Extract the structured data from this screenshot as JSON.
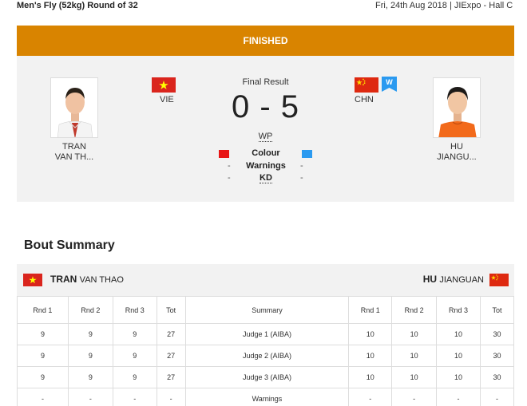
{
  "header": {
    "event": "Men's Fly (52kg) Round of 32",
    "meta": "Fri, 24th Aug 2018 | JIExpo - Hall C"
  },
  "status": "FINISHED",
  "result": {
    "final_label": "Final Result",
    "score": "0 - 5",
    "method": "WP",
    "winner_badge": "W"
  },
  "left_athlete": {
    "name_line1": "TRAN",
    "name_line2": "VAN TH...",
    "country_code": "VIE",
    "flag_colors": {
      "field": "#da251d",
      "star": "#ffff00"
    }
  },
  "right_athlete": {
    "name_line1": "HU",
    "name_line2": "JIANGU...",
    "country_code": "CHN",
    "flag_colors": {
      "field": "#de2910",
      "star": "#ffde00"
    }
  },
  "legend": {
    "rows": [
      {
        "label": "Colour",
        "left": "-",
        "right": "-"
      },
      {
        "label": "Warnings",
        "left": "-",
        "right": "-"
      },
      {
        "label": "KD",
        "left": "-",
        "right": "-"
      }
    ],
    "left_color": "#e81616",
    "right_color": "#2b9af0"
  },
  "bout_summary": {
    "title": "Bout Summary",
    "left_surname": "TRAN",
    "left_given": "VAN THAO",
    "right_surname": "HU",
    "right_given": "JIANGUAN",
    "columns": [
      "Rnd 1",
      "Rnd 2",
      "Rnd 3",
      "Tot",
      "Summary",
      "Rnd 1",
      "Rnd 2",
      "Rnd 3",
      "Tot"
    ],
    "rows": [
      [
        "9",
        "9",
        "9",
        "27",
        "Judge 1 (AIBA)",
        "10",
        "10",
        "10",
        "30"
      ],
      [
        "9",
        "9",
        "9",
        "27",
        "Judge 2 (AIBA)",
        "10",
        "10",
        "10",
        "30"
      ],
      [
        "9",
        "9",
        "9",
        "27",
        "Judge 3 (AIBA)",
        "10",
        "10",
        "10",
        "30"
      ],
      [
        "-",
        "-",
        "-",
        "-",
        "Warnings",
        "-",
        "-",
        "-",
        "-"
      ]
    ]
  },
  "colors": {
    "status_bar": "#d98400",
    "panel_bg": "#f2f2f2",
    "badge": "#2b9af0"
  }
}
